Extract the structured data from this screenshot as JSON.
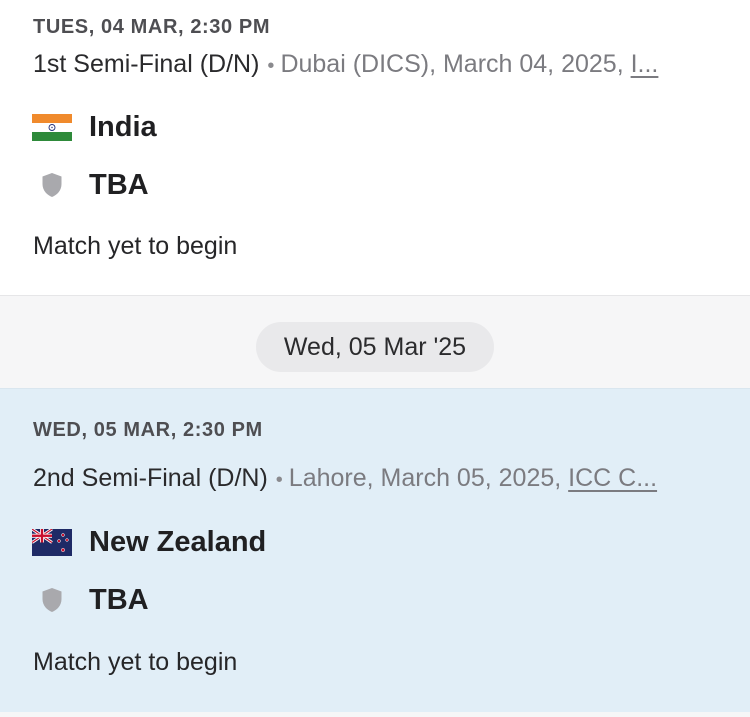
{
  "date_separator": "Wed, 05 Mar '25",
  "matches": [
    {
      "time": "TUES, 04 MAR, 2:30 PM",
      "name": "1st Semi-Final (D/N)",
      "separator": "•",
      "venue": "Dubai (DICS), March 04, 2025,",
      "series": "I...",
      "teams": [
        {
          "name": "India",
          "icon": "india-flag-icon"
        },
        {
          "name": "TBA",
          "icon": "shield-icon"
        }
      ],
      "status": "Match yet to begin"
    },
    {
      "time": "WED, 05 MAR, 2:30 PM",
      "name": "2nd Semi-Final (D/N)",
      "separator": "•",
      "venue": "Lahore, March 05, 2025,",
      "series": "ICC C...",
      "teams": [
        {
          "name": "New Zealand",
          "icon": "new-zealand-flag-icon"
        },
        {
          "name": "TBA",
          "icon": "shield-icon"
        }
      ],
      "status": "Match yet to begin"
    }
  ],
  "colors": {
    "card_default": "#ffffff",
    "card_highlight": "#e1eef7",
    "pill_bg": "#e9e9eb",
    "meta_text": "#7b7b80",
    "placeholder_shield": "#a9a9ad"
  }
}
